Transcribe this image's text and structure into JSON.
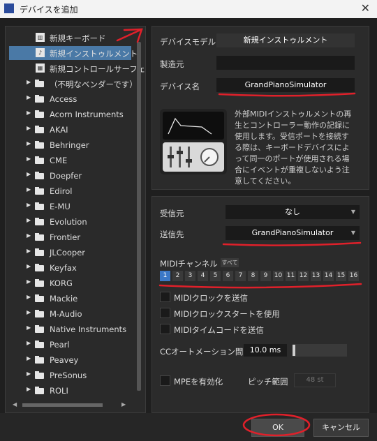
{
  "window": {
    "title": "デバイスを追加"
  },
  "tree": {
    "items": [
      {
        "label": "新規キーボード",
        "kind": "keyboard"
      },
      {
        "label": "新規インストゥルメント",
        "kind": "instrument",
        "selected": true
      },
      {
        "label": "新規コントロールサーフェス",
        "kind": "surface"
      },
      {
        "label": "（不明なベンダーです）",
        "kind": "folder"
      },
      {
        "label": "Access",
        "kind": "folder"
      },
      {
        "label": "Acorn Instruments",
        "kind": "folder"
      },
      {
        "label": "AKAI",
        "kind": "folder"
      },
      {
        "label": "Behringer",
        "kind": "folder"
      },
      {
        "label": "CME",
        "kind": "folder"
      },
      {
        "label": "Doepfer",
        "kind": "folder"
      },
      {
        "label": "Edirol",
        "kind": "folder"
      },
      {
        "label": "E-MU",
        "kind": "folder"
      },
      {
        "label": "Evolution",
        "kind": "folder"
      },
      {
        "label": "Frontier",
        "kind": "folder"
      },
      {
        "label": "JLCooper",
        "kind": "folder"
      },
      {
        "label": "Keyfax",
        "kind": "folder"
      },
      {
        "label": "KORG",
        "kind": "folder"
      },
      {
        "label": "Mackie",
        "kind": "folder"
      },
      {
        "label": "M-Audio",
        "kind": "folder"
      },
      {
        "label": "Native Instruments",
        "kind": "folder"
      },
      {
        "label": "Pearl",
        "kind": "folder"
      },
      {
        "label": "Peavey",
        "kind": "folder"
      },
      {
        "label": "PreSonus",
        "kind": "folder"
      },
      {
        "label": "ROLI",
        "kind": "folder"
      }
    ]
  },
  "device": {
    "model_label": "デバイスモデル",
    "model_value": "新規インストゥルメント",
    "maker_label": "製造元",
    "maker_value": "",
    "name_label": "デバイス名",
    "name_value": "GrandPianoSimulator",
    "description": "外部MIDIインストゥルメントの再生とコントローラー動作の記録に使用します。受信ポートを接続する際は、キーボードデバイスによって同一のポートが使用される場合にイベントが重複しないよう注意してください。"
  },
  "ports": {
    "receive_label": "受信元",
    "receive_value": "なし",
    "send_label": "送信先",
    "send_value": "GrandPianoSimulator"
  },
  "midi": {
    "channel_label": "MIDIチャンネル",
    "all_label": "すべて",
    "channels": [
      "1",
      "2",
      "3",
      "4",
      "5",
      "6",
      "7",
      "8",
      "9",
      "10",
      "11",
      "12",
      "13",
      "14",
      "15",
      "16"
    ],
    "active_channel": "1",
    "clock_send_label": "MIDIクロックを送信",
    "clock_start_label": "MIDIクロックスタートを使用",
    "timecode_label": "MIDIタイムコードを送信",
    "cc_label": "CCオートメーション間隔",
    "cc_value": "10.0 ms",
    "mpe_label": "MPEを有効化",
    "pitch_label": "ピッチ範囲",
    "pitch_value": "48 st"
  },
  "buttons": {
    "ok": "OK",
    "cancel": "キャンセル"
  },
  "colors": {
    "accent": "#3b78c6",
    "selection": "#4a79a6",
    "annotation": "#e0202a"
  }
}
